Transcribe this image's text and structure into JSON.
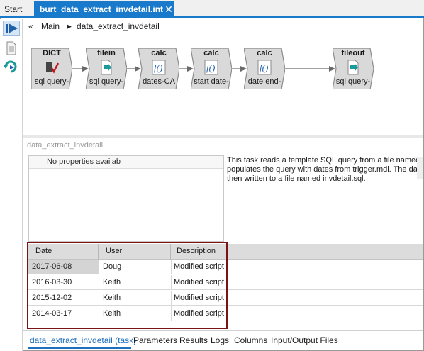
{
  "tabs": {
    "start_label": "Start",
    "active_label": "burt_data_extract_invdetail.int",
    "close_glyph": "✕"
  },
  "rail": {
    "icons": [
      "run-icon",
      "document-icon",
      "refresh-icon"
    ]
  },
  "breadcrumb": {
    "back_glyph": "«",
    "main": "Main",
    "separator": "▶",
    "current": "data_extract_invdetail"
  },
  "flow": {
    "nodes": [
      {
        "title": "DICT",
        "label": "sql query-",
        "icon": "dictionary-icon"
      },
      {
        "title": "filein",
        "label": "sql query-",
        "icon": "file-input-icon"
      },
      {
        "title": "calc",
        "label": "dates-CA",
        "icon": "function-icon"
      },
      {
        "title": "calc",
        "label": "start date-",
        "icon": "function-icon"
      },
      {
        "title": "calc",
        "label": "date end-",
        "icon": "function-icon"
      },
      {
        "title": "fileout",
        "label": "sql query-",
        "icon": "file-output-icon"
      }
    ]
  },
  "section_title": "data_extract_invdetail",
  "properties": {
    "empty_text": "No properties available"
  },
  "description": {
    "lines": [
      "This task reads a template SQL query from a file named inv",
      "populates the query with dates from trigger.mdl. The date-p",
      "then written to a file named invdetail.sql."
    ]
  },
  "history": {
    "columns": [
      "Date",
      "User",
      "Description"
    ],
    "rows": [
      {
        "date": "2017-06-08",
        "user": "Doug",
        "description": "Modified script"
      },
      {
        "date": "2016-03-30",
        "user": "Keith",
        "description": "Modified script"
      },
      {
        "date": "2015-12-02",
        "user": "Keith",
        "description": "Modified script"
      },
      {
        "date": "2014-03-17",
        "user": "Keith",
        "description": "Modified script"
      }
    ]
  },
  "bottom_tabs": [
    "data_extract_invdetail (task)",
    "Parameters",
    "Results",
    "Logs",
    "Columns",
    "Input/Output Files"
  ],
  "colors": {
    "accent": "#1979ca",
    "highlight_border": "#7a1313",
    "node_fill": "#d9d9d9",
    "icon_teal": "#1a9a9a"
  }
}
